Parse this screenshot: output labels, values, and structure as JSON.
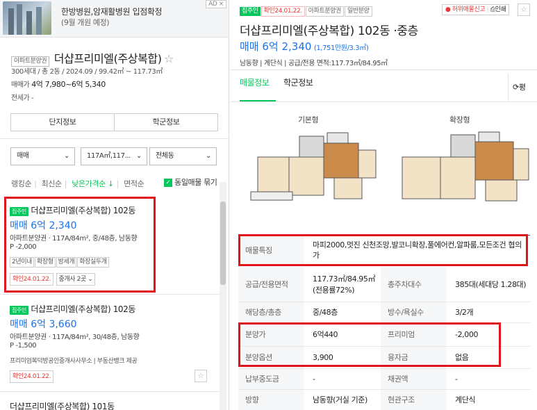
{
  "ad": {
    "text1": "한방병원,암재활병원 입점확정",
    "text2": "(9월 개원 예정)",
    "badge": "AD ×"
  },
  "complex": {
    "type_tag": "아파트분양권",
    "name": "더샵프리미엘(주상복합)",
    "star": "☆",
    "meta": "300세대 / 총 2동 / 2024.09 / 99.42㎡ ~ 117.73㎡",
    "price_label": "매매가",
    "price_range": "4억 7,980~6억 5,340",
    "rent_label": "전세가 -",
    "btn_complex": "단지정보",
    "btn_school": "학군정보"
  },
  "filters": {
    "deal": "매매",
    "area": "117A㎡,117...",
    "building": "전체동"
  },
  "sort": {
    "items": [
      "랭킹순",
      "최신순",
      "낮은가격순 ↓",
      "면적순"
    ],
    "same_listing": "동일매물 묶기"
  },
  "listings": [
    {
      "badge": "집주인",
      "title": "더샵프리미엘(주상복합) 102동",
      "price": "매매 6억 2,340",
      "detail": "아파트분양권 · 117A/84m², 중/48층, 남동향",
      "premium": "P -2,000",
      "tags": [
        "2년이내",
        "확장형",
        "방세개",
        "화장실두개"
      ],
      "confirm": "확인24.01.22.",
      "agents": "중개사 2곳 ⌄"
    },
    {
      "badge": "집주인",
      "title": "더샵프리미엘(주상복합) 102동",
      "price": "매매 6억 3,660",
      "detail": "아파트분양권 · 117A/84m², 30/48층, 남동향",
      "premium": "P -1,500",
      "agency": "프리미엄복덕방공인중개사사무소 | 부동산뱅크 제공",
      "confirm": "확인24.01.22."
    },
    {
      "title": "더샵프리미엘(주상복합) 101동"
    }
  ],
  "detail": {
    "tags": [
      "집주인",
      "확인24.01.22.",
      "아파트분양권",
      "일반분양"
    ],
    "report": "허위매물신고",
    "print": "인쇄",
    "title": "더샵프리미엘(주상복합) 102동 ·중층",
    "price_main": "매매 6억 2,340",
    "price_unit": "(1,751만원/3.3㎡)",
    "summary": "남동향 | 계단식 | 공급/전용 면적:117.73㎡/84.95㎡",
    "tabs": [
      "매물정보",
      "학군정보"
    ],
    "tab_right": "평",
    "plan_basic": "기본형",
    "plan_ext": "확장형",
    "features_label": "매물특징",
    "features": "마피2000,멋진 신천조망,발코니확장,풀에어컨,알파룸,모든조건 협의가",
    "rows": [
      {
        "k1": "공급/전용면적",
        "v1": "117.73㎡/84.95㎡(전용률72%)",
        "k2": "총주차대수",
        "v2": "385대(세대당 1.28대)"
      },
      {
        "k1": "해당층/총층",
        "v1": "중/48층",
        "k2": "방수/욕실수",
        "v2": "3/2개"
      },
      {
        "k1": "분양가",
        "v1": "6억440",
        "k2": "프리미엄",
        "v2": "-2,000"
      },
      {
        "k1": "분양옵션",
        "v1": "3,900",
        "k2": "융자금",
        "v2": "없음"
      },
      {
        "k1": "납부중도금",
        "v1": "-",
        "k2": "채권액",
        "v2": "-"
      },
      {
        "k1": "방향",
        "v1": "남동향(거실 기준)",
        "k2": "현관구조",
        "v2": "계단식"
      }
    ]
  },
  "colors": {
    "accent_green": "#03c75a",
    "price_blue": "#1a73e8",
    "highlight_red": "#e0141c"
  }
}
